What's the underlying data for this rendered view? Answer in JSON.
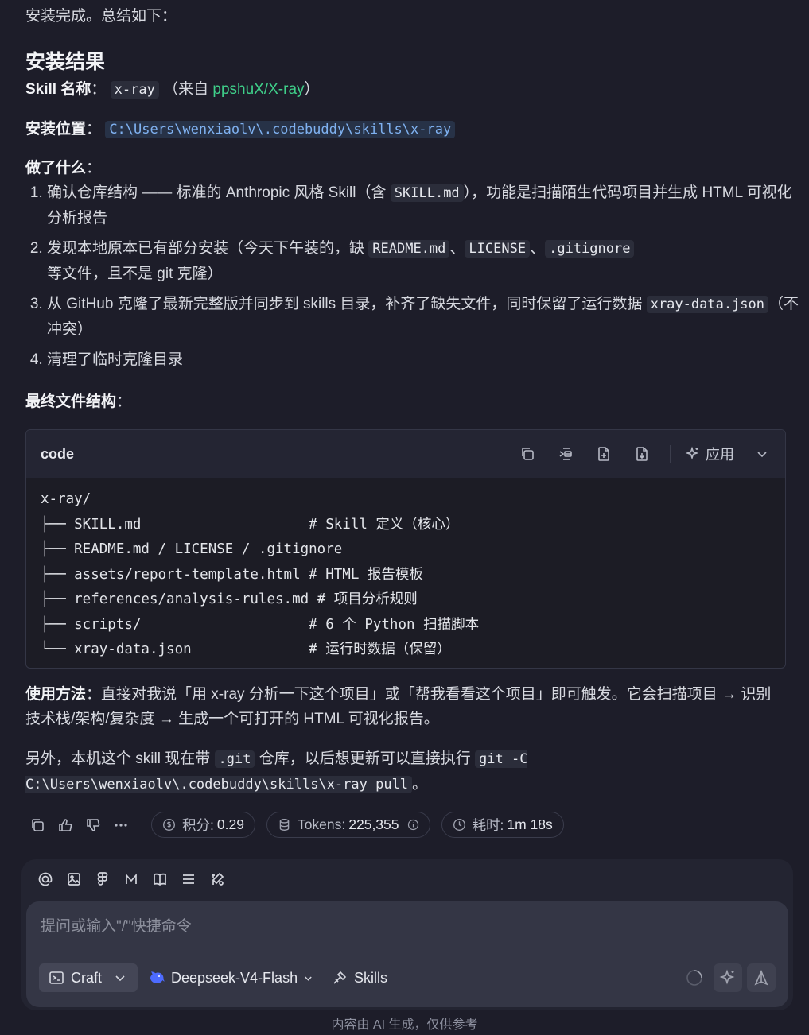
{
  "message": {
    "intro": "安装完成。总结如下：",
    "heading": "安装结果",
    "skill_name_label": "Skill 名称",
    "colon": "：",
    "skill_name": "x-ray",
    "source_prefix": "（来自 ",
    "source_link": "ppshuX/X-ray",
    "source_suffix": "）",
    "location_label": "安装位置",
    "location_path": "C:\\Users\\wenxiaolv\\.codebuddy\\skills\\x-ray",
    "done_label": "做了什么",
    "steps": {
      "s1_a": "确认仓库结构 —— 标准的 Anthropic 风格 Skill（含 ",
      "s1_code": "SKILL.md",
      "s1_b": "），功能是扫描陌生代码项目并生成 HTML 可视化分析报告",
      "s2_a": "发现本地原本已有部分安装（今天下午装的，缺 ",
      "s2_code1": "README.md",
      "s2_sep1": "、",
      "s2_code2": "LICENSE",
      "s2_sep2": "、",
      "s2_code3": ".gitignore",
      "s2_b": " 等文件，且不是 git 克隆）",
      "s3_a": "从 GitHub 克隆了最新完整版并同步到 skills 目录，补齐了缺失文件，同时保留了运行数据 ",
      "s3_code": "xray-data.json",
      "s3_b": "（不冲突）",
      "s4": "清理了临时克隆目录"
    },
    "structure_label": "最终文件结构",
    "usage_label": "使用方法",
    "usage_text": "：直接对我说「用 x-ray 分析一下这个项目」或「帮我看看这个项目」即可触发。它会扫描项目 → 识别技术栈/架构/复杂度 → 生成一个可打开的 HTML 可视化报告。",
    "extra_a": "另外，本机这个 skill 现在带 ",
    "extra_code1": ".git",
    "extra_b": " 仓库，以后想更新可以直接执行 ",
    "extra_code2": "git -C C:\\Users\\wenxiaolv\\.codebuddy\\skills\\x-ray pull",
    "extra_c": "。"
  },
  "code_block": {
    "title": "code",
    "apply_label": "应用",
    "lines": [
      "x-ray/",
      "├── SKILL.md                    # Skill 定义（核心）",
      "├── README.md / LICENSE / .gitignore",
      "├── assets/report-template.html # HTML 报告模板",
      "├── references/analysis-rules.md # 项目分析规则",
      "├── scripts/                    # 6 个 Python 扫描脚本",
      "└── xray-data.json              # 运行时数据（保留）"
    ],
    "toolbar_icons": [
      "copy-icon",
      "insert-icon",
      "new-file-icon",
      "save-file-icon",
      "sparkle-icon",
      "chevron-down-icon"
    ]
  },
  "meta": {
    "credits_label": "积分:",
    "credits_value": "0.29",
    "tokens_label": "Tokens:",
    "tokens_value": "225,355",
    "time_label": "耗时:",
    "time_value": "1m 18s"
  },
  "composer": {
    "placeholder": "提问或输入\"/\"快捷命令",
    "mode_label": "Craft",
    "model_label": "Deepseek-V4-Flash",
    "skills_label": "Skills",
    "tool_icons": [
      "at-icon",
      "image-icon",
      "figma-icon",
      "m-icon",
      "book-icon",
      "list-icon",
      "tools-icon"
    ]
  },
  "footer": "内容由 AI 生成，仅供参考",
  "colors": {
    "background": "#1d1d29",
    "link": "#3fd08a",
    "path": "#7fb1f0",
    "panel": "#232431"
  }
}
